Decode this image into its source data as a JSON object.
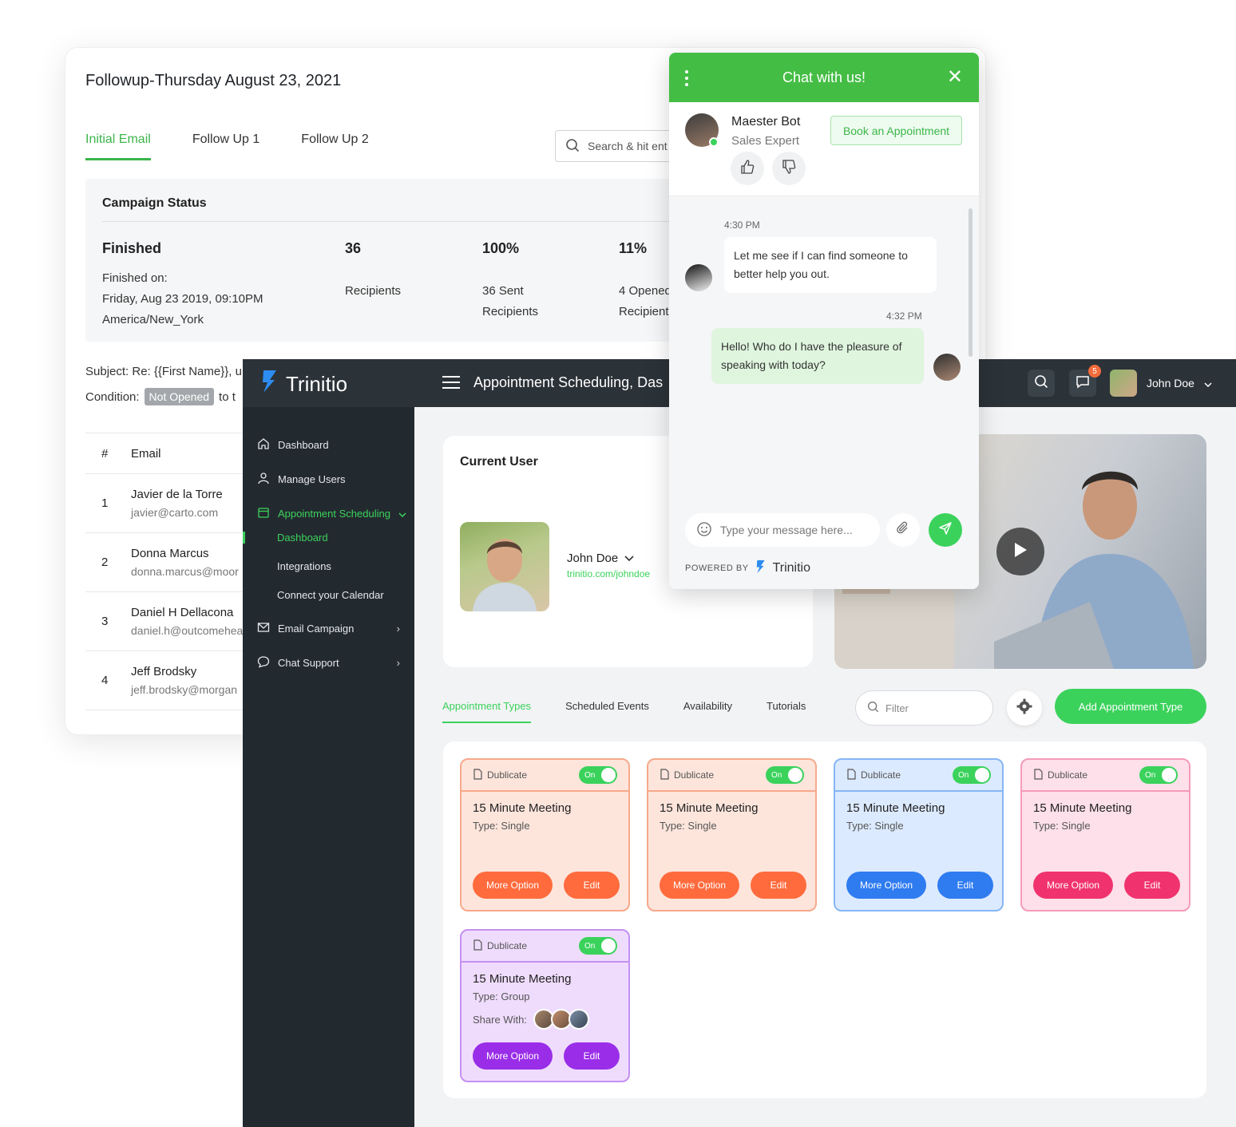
{
  "email_campaign": {
    "title": "Followup-Thursday August 23, 2021",
    "tabs": [
      "Initial Email",
      "Follow Up 1",
      "Follow Up 2"
    ],
    "search_placeholder": "Search & hit ent",
    "campaign_status": {
      "heading": "Campaign Status",
      "status": "Finished",
      "finished_on_label": "Finished on:",
      "finished_date": "Friday, Aug 23 2019, 09:10PM",
      "timezone": "America/New_York",
      "recipients_count": "36",
      "recipients_label": "Recipients",
      "sent_pct": "100%",
      "sent_label": "36 Sent",
      "sent_sub": "Recipients",
      "opened_pct": "11%",
      "opened_label": "4 Opened",
      "opened_sub": "Recipient"
    },
    "subject": "Subject: Re: {{First Name}}, u",
    "condition_label": "Condition:",
    "condition_badge": "Not Opened",
    "condition_tail": "to t",
    "table": {
      "headers": [
        "#",
        "Email"
      ],
      "rows": [
        {
          "num": "1",
          "name": "Javier de la Torre",
          "email": "javier@carto.com"
        },
        {
          "num": "2",
          "name": "Donna Marcus",
          "email": "donna.marcus@moor"
        },
        {
          "num": "3",
          "name": "Daniel H Dellacona",
          "email": "daniel.h@outcomehea"
        },
        {
          "num": "4",
          "name": "Jeff Brodsky",
          "email": "jeff.brodsky@morgan"
        }
      ]
    }
  },
  "app": {
    "brand": "Trinitio",
    "page_title": "Appointment Scheduling, Das",
    "notification_count": "5",
    "user_name": "John Doe",
    "sidebar": {
      "dashboard": "Dashboard",
      "manage_users": "Manage Users",
      "appointment_scheduling": "Appointment Scheduling",
      "sub_dashboard": "Dashboard",
      "sub_integrations": "Integrations",
      "sub_connect": "Connect your Calendar",
      "email_campaign": "Email Campaign",
      "chat_support": "Chat Support"
    },
    "current_user": {
      "title": "Current User",
      "name": "John Doe",
      "link": "trinitio.com/johndoe"
    },
    "tabs": [
      "Appointment Types",
      "Scheduled Events",
      "Availability",
      "Tutorials"
    ],
    "filter_placeholder": "Filter",
    "add_button": "Add Appointment Type",
    "cards": [
      {
        "dup": "Dublicate",
        "toggle": "On",
        "name": "15 Minute Meeting",
        "type": "Type: Single",
        "more": "More Option",
        "edit": "Edit",
        "theme": "orange"
      },
      {
        "dup": "Dublicate",
        "toggle": "On",
        "name": "15 Minute Meeting",
        "type": "Type: Single",
        "more": "More Option",
        "edit": "Edit",
        "theme": "orange"
      },
      {
        "dup": "Dublicate",
        "toggle": "On",
        "name": "15 Minute Meeting",
        "type": "Type: Single",
        "more": "More Option",
        "edit": "Edit",
        "theme": "blue"
      },
      {
        "dup": "Dublicate",
        "toggle": "On",
        "name": "15 Minute Meeting",
        "type": "Type: Single",
        "more": "More Option",
        "edit": "Edit",
        "theme": "pink"
      },
      {
        "dup": "Dublicate",
        "toggle": "On",
        "name": "15 Minute Meeting",
        "type": "Type: Group",
        "share": "Share With:",
        "more": "More Option",
        "edit": "Edit",
        "theme": "purple"
      }
    ],
    "colors": {
      "accent": "#3bd25c",
      "topbar": "#2b3238",
      "sidebar": "#232a2f"
    }
  },
  "chat": {
    "header": "Chat with us!",
    "bot_name": "Maester Bot",
    "bot_role": "Sales Expert",
    "book_button": "Book an Appointment",
    "messages": [
      {
        "time": "4:30 PM",
        "text": "Let me see if I can find someone to better help you out."
      },
      {
        "time": "4:32 PM",
        "text": "Hello! Who do I have the pleasure of speaking with today?"
      }
    ],
    "input_placeholder": "Type your message here...",
    "powered_by": "POWERED BY",
    "powered_brand": "Trinitio",
    "header_color": "#44bd44"
  }
}
